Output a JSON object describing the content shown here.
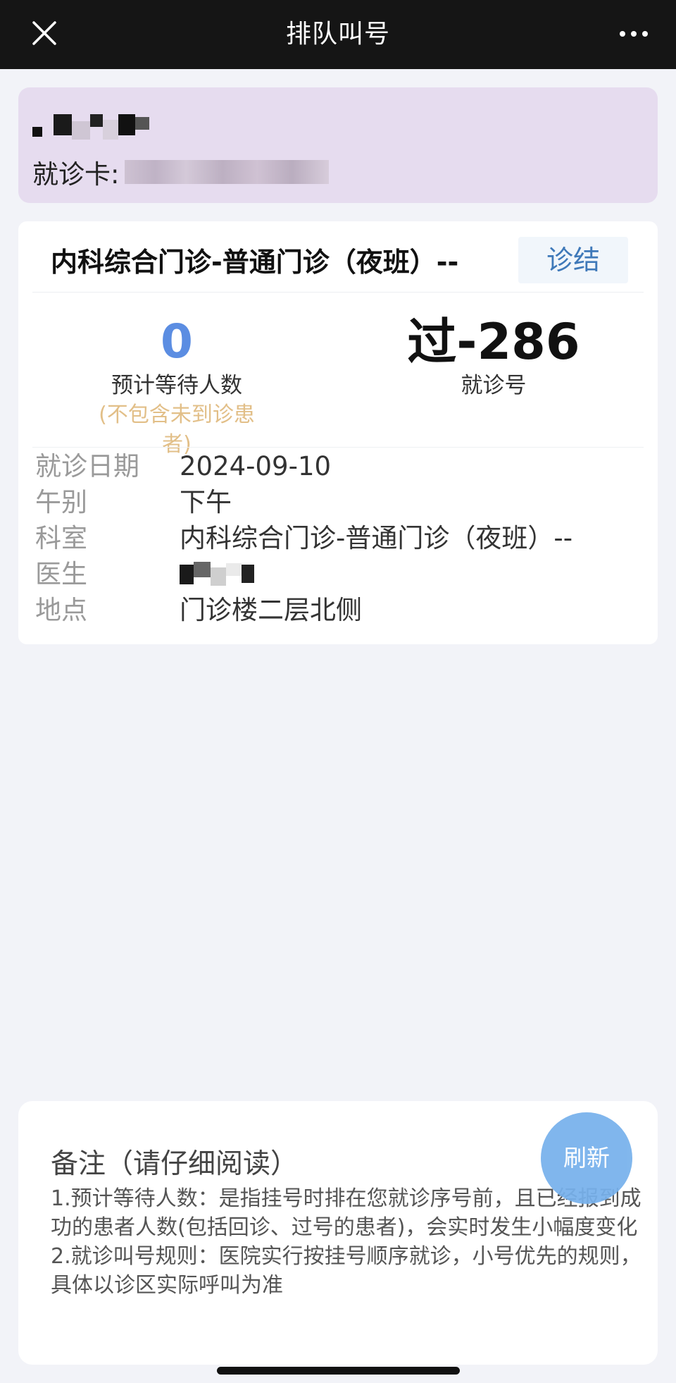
{
  "header": {
    "title": "排队叫号",
    "close_icon": "close-icon",
    "more_icon": "more-icon"
  },
  "patient": {
    "card_label": "就诊卡:"
  },
  "queue": {
    "dept_title": "内科综合门诊-普通门诊（夜班）--",
    "status": "诊结",
    "waiting_count": "0",
    "waiting_label": "预计等待人数",
    "waiting_note": "(不包含未到诊患者)",
    "visit_number": "过-286",
    "visit_number_label": "就诊号",
    "colors": {
      "accent_blue": "#5b8de2",
      "status_blue": "#3f79b9",
      "note_orange": "#e2bf88",
      "patient_card_bg": "#e6dcef"
    }
  },
  "details": [
    {
      "key": "就诊日期",
      "value": "2024-09-10"
    },
    {
      "key": "午别",
      "value": "下午"
    },
    {
      "key": "科室",
      "value": "内科综合门诊-普通门诊（夜班）--"
    },
    {
      "key": "医生",
      "value": ""
    },
    {
      "key": "地点",
      "value": "门诊楼二层北侧"
    }
  ],
  "notes": {
    "title": "备注（请仔细阅读）",
    "line1": "1.预计等待人数：是指挂号时排在您就诊序号前，且已经报到成功的患者人数(包括回诊、过号的患者)，会实时发生小幅度变化",
    "line2": "2.就诊叫号规则：医院实行按挂号顺序就诊，小号优先的规则，具体以诊区实际呼叫为准"
  },
  "refresh_button": "刷新"
}
